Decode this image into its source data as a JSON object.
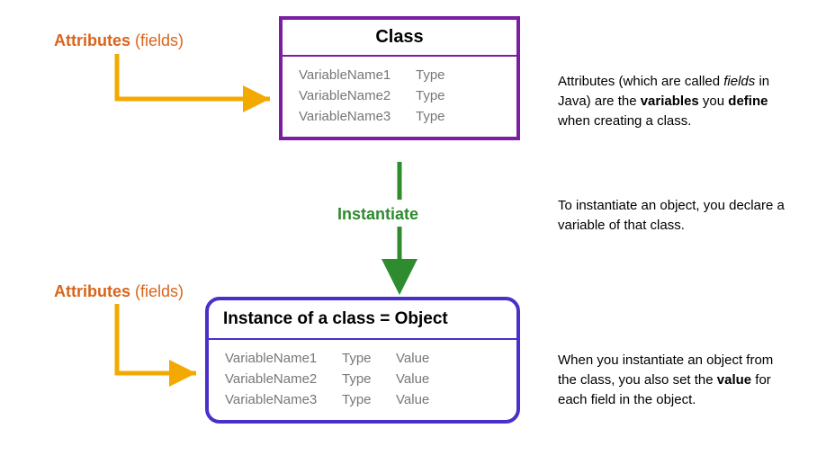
{
  "colors": {
    "purple": "#7a1fa2",
    "blue": "#4b2fc9",
    "orange": "#d9641a",
    "green": "#2e8b2e",
    "yellowArrow": "#f4a900"
  },
  "labels": {
    "attributes": "Attributes ",
    "fields": "(fields)",
    "instantiate": "Instantiate"
  },
  "classBox": {
    "title": "Class",
    "rows": [
      {
        "name": "VariableName1",
        "type": "Type"
      },
      {
        "name": "VariableName2",
        "type": "Type"
      },
      {
        "name": "VariableName3",
        "type": "Type"
      }
    ]
  },
  "objectBox": {
    "title_a": "Instance of a class",
    "title_eq": " = ",
    "title_b": "Object",
    "rows": [
      {
        "name": "VariableName1",
        "type": "Type",
        "value": "Value"
      },
      {
        "name": "VariableName2",
        "type": "Type",
        "value": "Value"
      },
      {
        "name": "VariableName3",
        "type": "Type",
        "value": "Value"
      }
    ]
  },
  "explanations": {
    "e1_a": "Attributes (which are called ",
    "e1_b": "fields",
    "e1_c": " in Java) are the ",
    "e1_d": "variables",
    "e1_e": " you ",
    "e1_f": "define",
    "e1_g": " when creating a class.",
    "e2": "To instantiate an object, you declare a variable of that class.",
    "e3_a": "When you instantiate an object from the class, you also set the ",
    "e3_b": "value",
    "e3_c": " for each field in the object."
  }
}
